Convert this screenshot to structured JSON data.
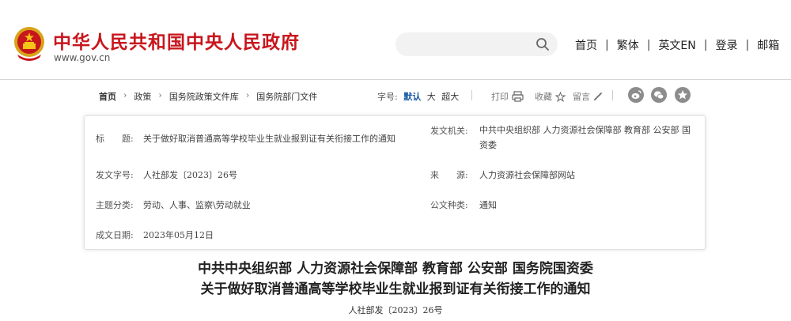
{
  "header": {
    "site_name": "中华人民共和国中央人民政府",
    "site_url": "www.gov.cn",
    "search": {
      "placeholder": ""
    },
    "nav": [
      "首页",
      "繁体",
      "英文EN",
      "登录",
      "邮箱"
    ]
  },
  "subbar": {
    "breadcrumbs": [
      "首页",
      "政策",
      "国务院政策文件库",
      "国务院部门文件"
    ],
    "font_size": {
      "label": "字号:",
      "options": [
        "默认",
        "大",
        "超大"
      ]
    },
    "print_label": "打印",
    "favorite_label": "收藏",
    "comment_label": "留言",
    "share_icons": [
      "weibo-icon",
      "wechat-icon",
      "qzone-icon"
    ]
  },
  "meta": {
    "title_label": "标　　题:",
    "title_value": "关于做好取消普通高等学校毕业生就业报到证有关衔接工作的通知",
    "issuer_label": "发文机关:",
    "issuer_value": "中共中央组织部 人力资源社会保障部 教育部 公安部 国资委",
    "doc_number_label": "发文字号:",
    "doc_number_value": "人社部发〔2023〕26号",
    "source_label": "来　　源:",
    "source_value": "人力资源社会保障部网站",
    "category_label": "主题分类:",
    "category_value": "劳动、人事、监察\\劳动就业",
    "doc_type_label": "公文种类:",
    "doc_type_value": "通知",
    "date_label": "成文日期:",
    "date_value": "2023年05月12日"
  },
  "document": {
    "issuers_line": "中共中央组织部 人力资源社会保障部 教育部 公安部 国务院国资委",
    "title": "关于做好取消普通高等学校毕业生就业报到证有关衔接工作的通知",
    "number": "人社部发〔2023〕26号"
  },
  "colors": {
    "brand_red": "#c8161d",
    "accent_blue": "#1a5aa6",
    "share_gray": "#8c8c8c"
  }
}
